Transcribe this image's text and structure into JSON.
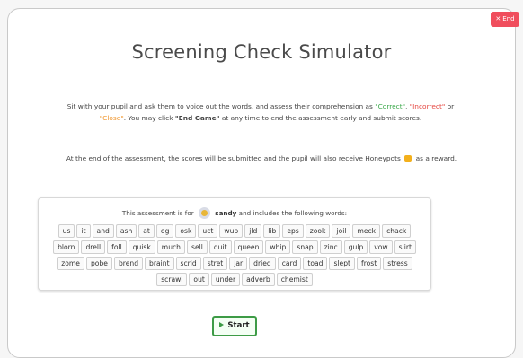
{
  "end_button": {
    "label": "End"
  },
  "title": "Screening Check Simulator",
  "instructions": {
    "part1": "Sit with your pupil and ask them to voice out the words, and assess their comprehension as ",
    "correct": "\"Correct\"",
    "sep1": ", ",
    "incorrect": "\"Incorrect\"",
    "or": " or",
    "close": "\"Close\"",
    "part2": ". You may click ",
    "end_game": "\"End Game\"",
    "part3": " at any time to end the assessment early and submit scores."
  },
  "reward": {
    "text_before": "At the end of the assessment, the scores will be submitted and the pupil will also receive Honeypots",
    "text_after": "as a reward."
  },
  "assessment": {
    "intro": "This assessment is for",
    "pupil_name": "sandy",
    "outro": "and includes the following words:",
    "word_rows": [
      [
        "us",
        "it",
        "and",
        "ash",
        "at",
        "og",
        "osk",
        "uct",
        "wup",
        "jld",
        "lib",
        "eps",
        "zook",
        "joil",
        "meck",
        "chack"
      ],
      [
        "blorn",
        "drell",
        "foll",
        "quisk",
        "much",
        "sell",
        "quit",
        "queen",
        "whip",
        "snap",
        "zinc",
        "gulp",
        "vow",
        "slirt"
      ],
      [
        "zome",
        "pobe",
        "brend",
        "braint",
        "scrid",
        "stret",
        "jar",
        "dried",
        "card",
        "toad",
        "slept",
        "frost",
        "stress"
      ],
      [
        "scrawl",
        "out",
        "under",
        "adverb",
        "chemist"
      ]
    ]
  },
  "start_button": {
    "label": "Start"
  },
  "colors": {
    "correct": "#3aa84a",
    "incorrect": "#e5453f",
    "close": "#f0962e",
    "end_button": "#f04e5d",
    "start_border": "#3d9b46"
  }
}
